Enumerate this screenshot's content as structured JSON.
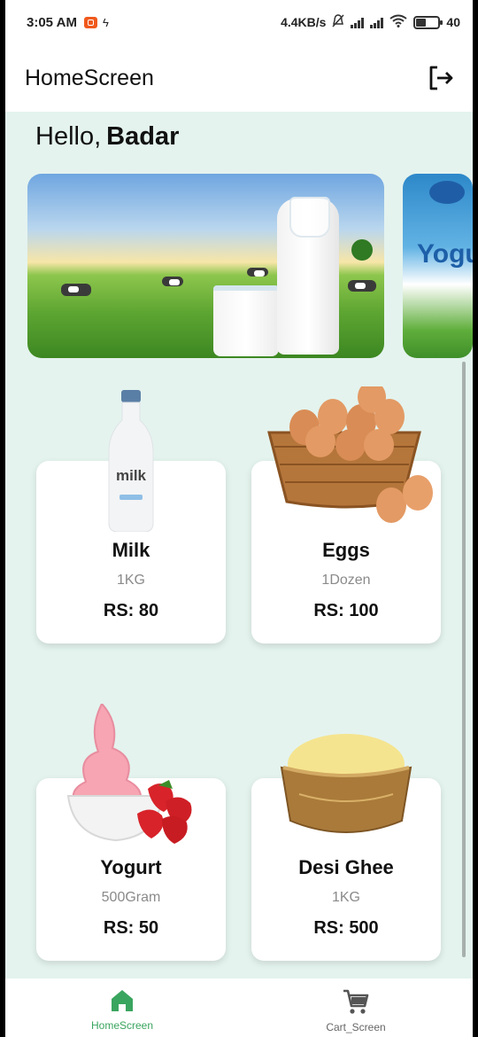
{
  "status_bar": {
    "time": "3:05 AM",
    "network_speed": "4.4KB/s",
    "battery": "40"
  },
  "app_bar": {
    "title": "HomeScreen",
    "logout_icon": "logout-icon"
  },
  "greeting": {
    "prefix": "Hello,",
    "name": "Badar"
  },
  "banners": [
    {
      "icon": "milk-farm-banner"
    },
    {
      "text": "Yogu"
    }
  ],
  "products": [
    {
      "name": "Milk",
      "unit": "1KG",
      "price": "RS: 80",
      "icon": "milk-bottle-image"
    },
    {
      "name": "Eggs",
      "unit": "1Dozen",
      "price": "RS: 100",
      "icon": "egg-basket-image"
    },
    {
      "name": "Yogurt",
      "unit": "500Gram",
      "price": "RS: 50",
      "icon": "yogurt-bowl-image"
    },
    {
      "name": "Desi Ghee",
      "unit": "1KG",
      "price": "RS: 500",
      "icon": "ghee-bowl-image"
    }
  ],
  "bottom_nav": {
    "items": [
      {
        "label": "HomeScreen",
        "icon": "home-icon",
        "active": true
      },
      {
        "label": "Cart_Screen",
        "icon": "cart-icon",
        "active": false
      }
    ]
  },
  "colors": {
    "background": "#e4f3ee",
    "accent": "#3aa55f"
  }
}
